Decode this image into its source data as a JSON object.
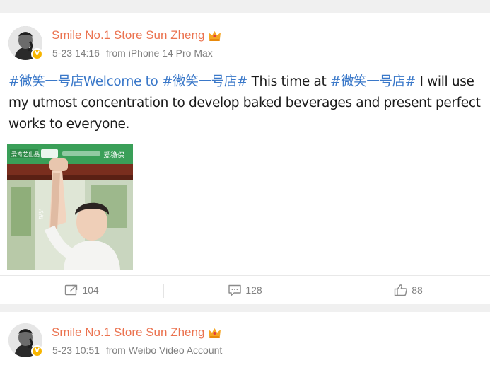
{
  "posts": [
    {
      "username": "Smile No.1 Store Sun Zheng",
      "date": "5-23 14:16",
      "source": "from iPhone 14 Pro Max",
      "segments": [
        {
          "type": "hashtag",
          "text": "#微笑一号店"
        },
        {
          "type": "hashtag",
          "text": "Welcome to #微笑一号店#"
        },
        {
          "type": "text",
          "text": " This time at "
        },
        {
          "type": "hashtag",
          "text": "#微笑一号店#"
        },
        {
          "type": "text",
          "text": " I will use my utmost concentration to develop baked beverages and present perfect works to everyone."
        }
      ],
      "media": {
        "badge_left": "爱奇艺出品",
        "badge_mid": "",
        "tagline": "",
        "title": "爱稳保",
        "side_text": "孙政"
      },
      "actions": {
        "repost": "104",
        "comment": "128",
        "like": "88"
      }
    },
    {
      "username": "Smile No.1 Store Sun Zheng",
      "date": "5-23 10:51",
      "source": "from Weibo Video Account"
    }
  ],
  "icons": {
    "verified": "verified-v-badge",
    "crown": "vip-crown-icon",
    "repost": "repost-icon",
    "comment": "comment-icon",
    "like": "like-thumb-icon"
  },
  "colors": {
    "username": "#eb7350",
    "hashtag": "#3a78c9",
    "meta": "#808080",
    "verified": "#f7b500"
  }
}
